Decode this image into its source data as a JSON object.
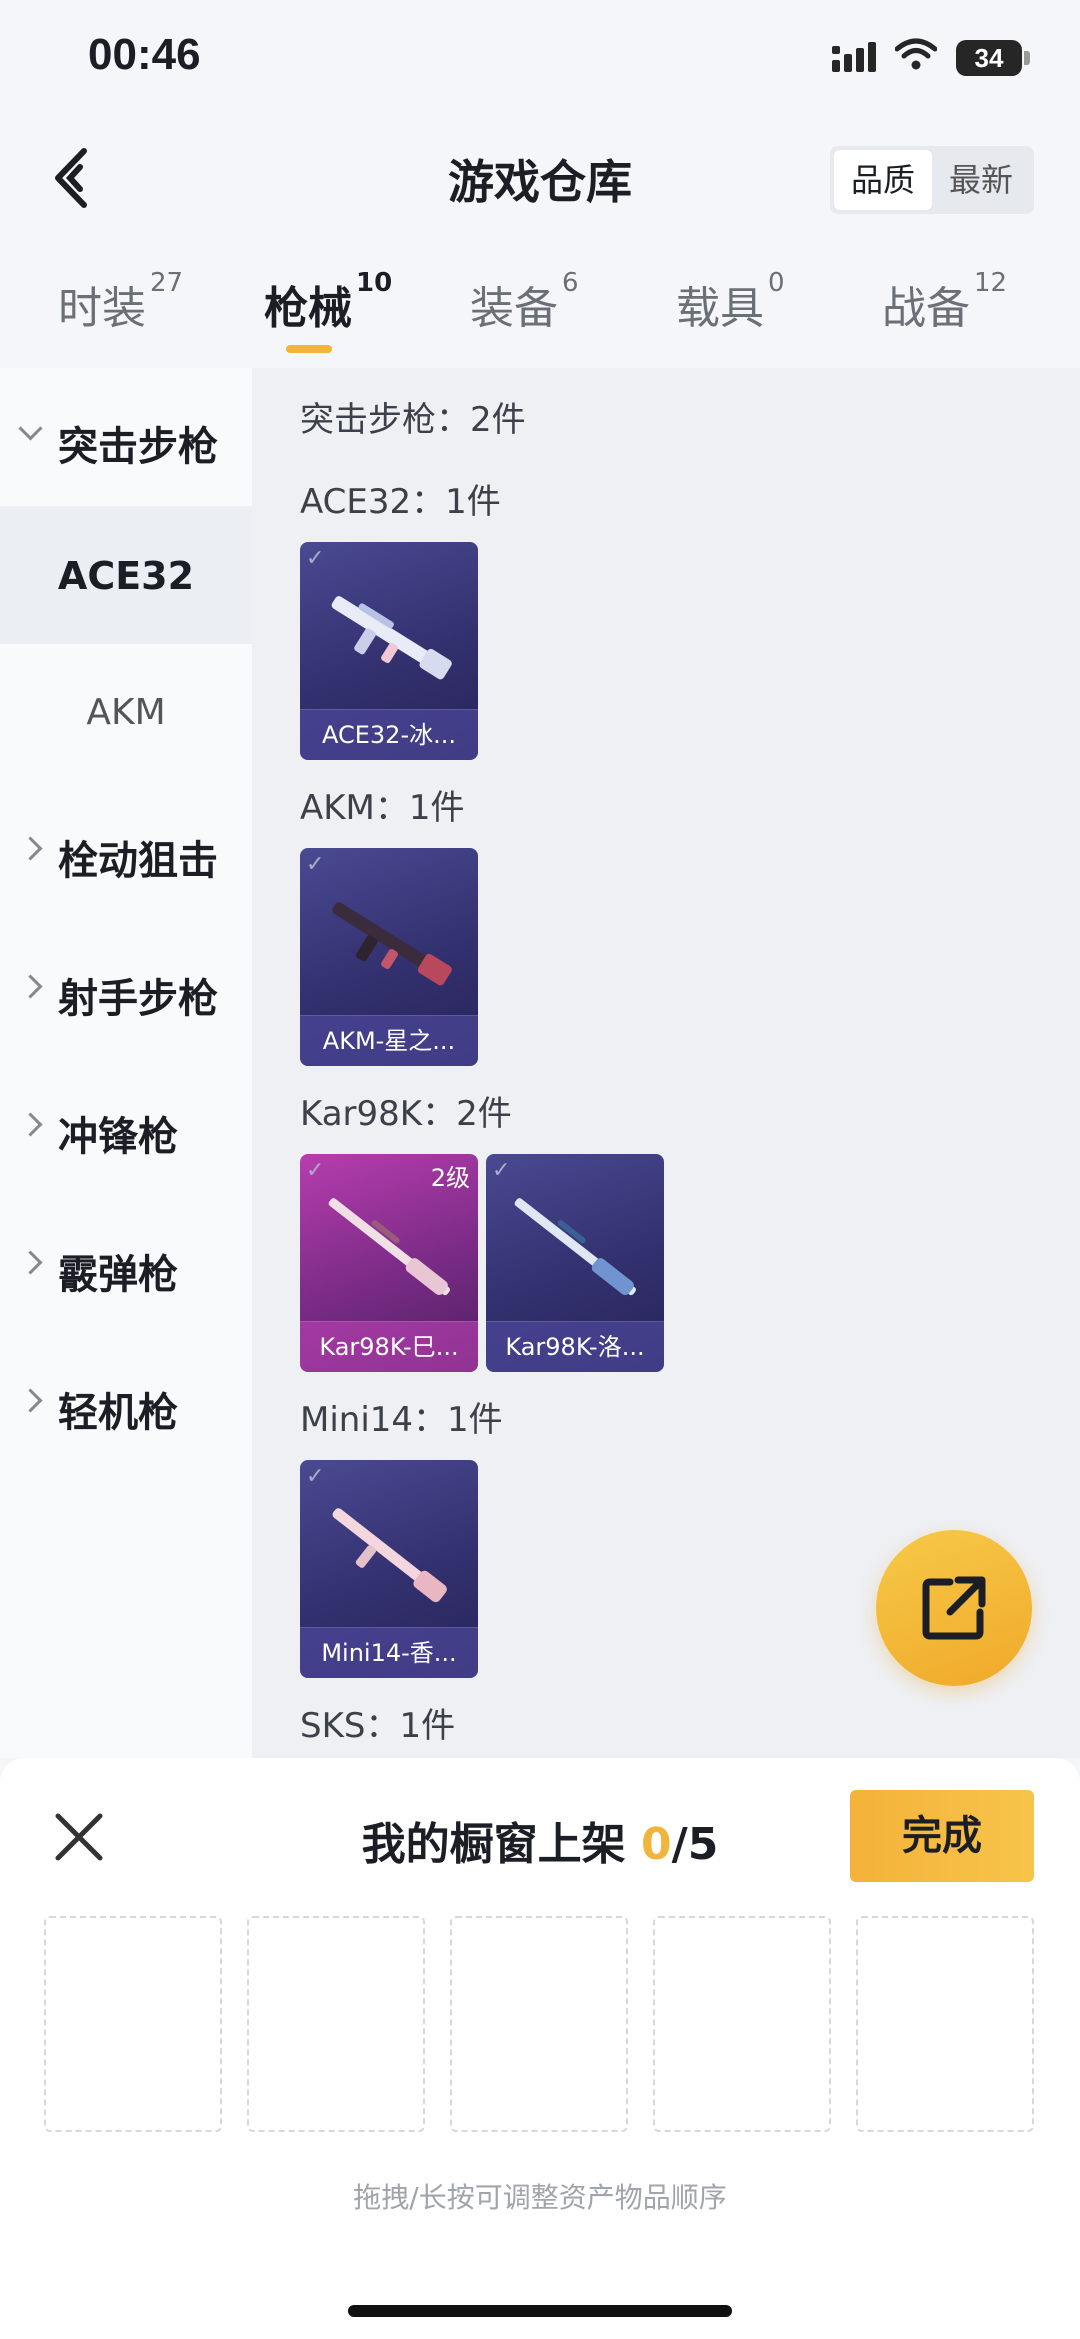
{
  "status": {
    "time": "00:46",
    "battery": "34"
  },
  "header": {
    "title": "游戏仓库",
    "sort_options": [
      "品质",
      "最新"
    ],
    "sort_selected": "品质"
  },
  "tabs": [
    {
      "label": "时装",
      "count": "27"
    },
    {
      "label": "枪械",
      "count": "10"
    },
    {
      "label": "装备",
      "count": "6"
    },
    {
      "label": "载具",
      "count": "0"
    },
    {
      "label": "战备",
      "count": "12"
    }
  ],
  "active_tab": "枪械",
  "sidebar": {
    "items": [
      {
        "label": "突击步枪",
        "type": "group",
        "expanded": true
      },
      {
        "label": "ACE32",
        "type": "sub",
        "selected": true
      },
      {
        "label": "AKM",
        "type": "sub",
        "selected": false
      },
      {
        "label": "栓动狙击",
        "type": "group",
        "expanded": false
      },
      {
        "label": "射手步枪",
        "type": "group",
        "expanded": false
      },
      {
        "label": "冲锋枪",
        "type": "group",
        "expanded": false
      },
      {
        "label": "霰弹枪",
        "type": "group",
        "expanded": false
      },
      {
        "label": "轻机枪",
        "type": "group",
        "expanded": false
      }
    ]
  },
  "content": {
    "section_title": "突击步枪：2件",
    "groups": [
      {
        "label": "ACE32：1件",
        "items": [
          {
            "name": "ACE32-冰...",
            "level": "",
            "color": "#3a3580"
          }
        ]
      },
      {
        "label": "AKM：1件",
        "items": [
          {
            "name": "AKM-星之...",
            "level": "",
            "color": "#3a3580"
          }
        ]
      },
      {
        "label": "Kar98K：2件",
        "items": [
          {
            "name": "Kar98K-巳...",
            "level": "2级",
            "color": "#8a2d92"
          },
          {
            "name": "Kar98K-洛...",
            "level": "",
            "color": "#3a3580"
          }
        ]
      },
      {
        "label": "Mini14：1件",
        "items": [
          {
            "name": "Mini14-香...",
            "level": "",
            "color": "#3a3580"
          }
        ]
      },
      {
        "label": "SKS：1件",
        "items": []
      }
    ]
  },
  "sheet": {
    "title": "我的橱窗上架",
    "count": "0",
    "total": "/5",
    "done_label": "完成",
    "slots": 5,
    "hint": "拖拽/长按可调整资产物品顺序"
  },
  "colors": {
    "accent": "#f0b53a",
    "rare_card": "#3a3580",
    "epic_card": "#8a2d92"
  }
}
